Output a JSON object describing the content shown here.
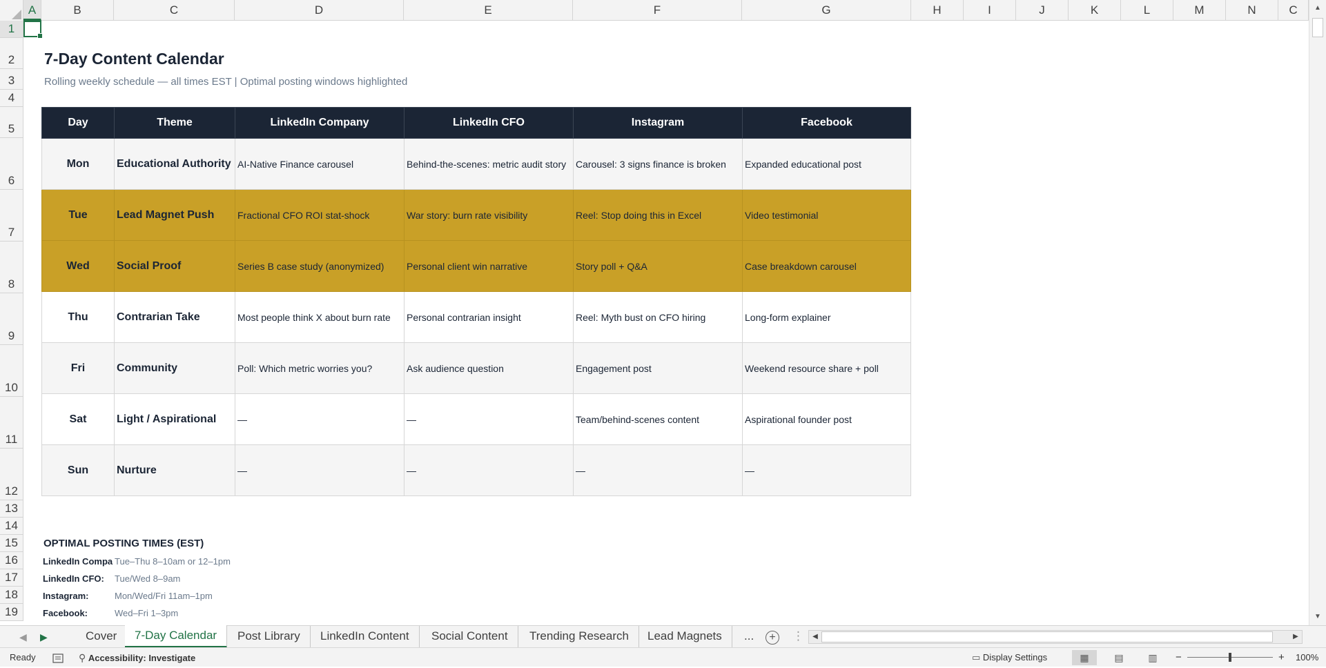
{
  "columns": [
    "A",
    "B",
    "C",
    "D",
    "E",
    "F",
    "G",
    "H",
    "I",
    "J",
    "K",
    "L",
    "M",
    "N",
    "C"
  ],
  "rows": [
    "1",
    "2",
    "3",
    "4",
    "5",
    "6",
    "7",
    "8",
    "9",
    "10",
    "11",
    "12",
    "13",
    "14",
    "15",
    "16",
    "17",
    "18",
    "19"
  ],
  "sheet": {
    "title": "7-Day Content Calendar",
    "subtitle": "Rolling weekly schedule — all times EST | Optimal posting windows highlighted"
  },
  "calendar": {
    "headers": [
      "Day",
      "Theme",
      "LinkedIn Company",
      "LinkedIn CFO",
      "Instagram",
      "Facebook"
    ],
    "rows": [
      {
        "day": "Mon",
        "theme": "Educational Authority",
        "linkedin_company": "AI-Native Finance carousel",
        "linkedin_cfo": "Behind-the-scenes: metric audit story",
        "instagram": "Carousel: 3 signs finance is broken",
        "facebook": "Expanded educational post",
        "highlight": false
      },
      {
        "day": "Tue",
        "theme": "Lead Magnet Push",
        "linkedin_company": "Fractional CFO ROI stat-shock",
        "linkedin_cfo": "War story: burn rate visibility",
        "instagram": "Reel: Stop doing this in Excel",
        "facebook": "Video testimonial",
        "highlight": true
      },
      {
        "day": "Wed",
        "theme": "Social Proof",
        "linkedin_company": "Series B case study (anonymized)",
        "linkedin_cfo": "Personal client win narrative",
        "instagram": "Story poll + Q&A",
        "facebook": "Case breakdown carousel",
        "highlight": true
      },
      {
        "day": "Thu",
        "theme": "Contrarian Take",
        "linkedin_company": "Most people think X about burn rate",
        "linkedin_cfo": "Personal contrarian insight",
        "instagram": "Reel: Myth bust on CFO hiring",
        "facebook": "Long-form explainer",
        "highlight": false
      },
      {
        "day": "Fri",
        "theme": "Community",
        "linkedin_company": "Poll: Which metric worries you?",
        "linkedin_cfo": "Ask audience question",
        "instagram": "Engagement post",
        "facebook": "Weekend resource share + poll",
        "highlight": false
      },
      {
        "day": "Sat",
        "theme": "Light / Aspirational",
        "linkedin_company": "—",
        "linkedin_cfo": "—",
        "instagram": "Team/behind-scenes content",
        "facebook": "Aspirational founder post",
        "highlight": false
      },
      {
        "day": "Sun",
        "theme": "Nurture",
        "linkedin_company": "—",
        "linkedin_cfo": "—",
        "instagram": "—",
        "facebook": "—",
        "highlight": false
      }
    ]
  },
  "optimal": {
    "title": "OPTIMAL POSTING TIMES (EST)",
    "items": [
      {
        "label": "LinkedIn Company:",
        "value": "Tue–Thu 8–10am or 12–1pm"
      },
      {
        "label": "LinkedIn CFO:",
        "value": "Tue/Wed 8–9am"
      },
      {
        "label": "Instagram:",
        "value": "Mon/Wed/Fri 11am–1pm"
      },
      {
        "label": "Facebook:",
        "value": "Wed–Fri 1–3pm"
      }
    ]
  },
  "tabs": [
    "Cover",
    "7-Day Calendar",
    "Post Library",
    "LinkedIn Content",
    "Social Content",
    "Trending Research",
    "Lead Magnets"
  ],
  "active_tab": "7-Day Calendar",
  "tab_more": "...",
  "status": {
    "ready": "Ready",
    "accessibility": "Accessibility: Investigate",
    "display_settings": "Display Settings",
    "zoom": "100%"
  },
  "colors": {
    "header_navy": "#1b2535",
    "highlight_gold": "#c9a027",
    "excel_green": "#217346"
  }
}
